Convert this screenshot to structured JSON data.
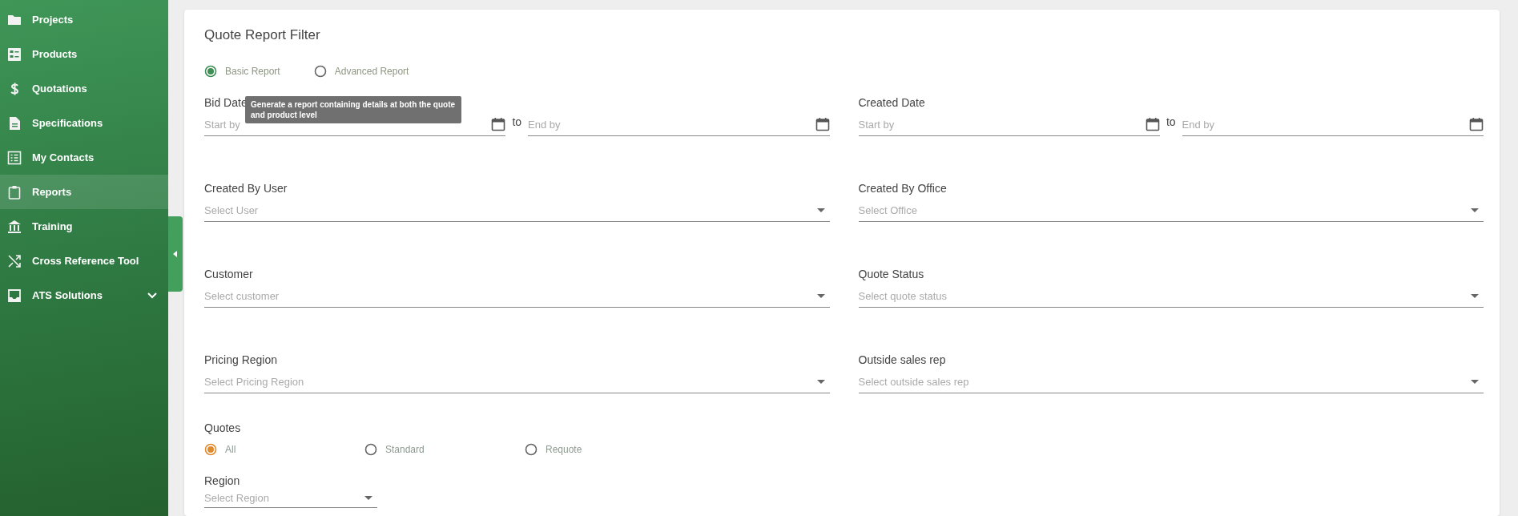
{
  "sidebar": {
    "items": [
      {
        "label": "Projects",
        "kind": "link",
        "selected": false
      },
      {
        "label": "Products",
        "kind": "link",
        "selected": false
      },
      {
        "label": "Quotations",
        "kind": "link",
        "selected": false
      },
      {
        "label": "Specifications",
        "kind": "link",
        "selected": false
      },
      {
        "label": "My Contacts",
        "kind": "link",
        "selected": false
      },
      {
        "label": "Reports",
        "kind": "link",
        "selected": true
      },
      {
        "label": "Training",
        "kind": "link",
        "selected": false
      },
      {
        "label": "Cross Reference Tool",
        "kind": "link",
        "selected": false
      },
      {
        "label": "ATS Solutions",
        "kind": "group",
        "selected": false
      }
    ]
  },
  "filter": {
    "title": "Quote Report Filter",
    "report_types": [
      {
        "label": "Basic Report",
        "selected": true
      },
      {
        "label": "Advanced Report",
        "selected": false
      }
    ],
    "tooltip": "Generate a report containing details at both the quote and product level",
    "fields": [
      {
        "kind": "date_range",
        "label": "Bid Date",
        "start_placeholder": "Start by",
        "separator": "to",
        "end_placeholder": "End by"
      },
      {
        "kind": "date_range",
        "label": "Created Date",
        "start_placeholder": "Start by",
        "separator": "to",
        "end_placeholder": "End by"
      },
      {
        "kind": "select",
        "label": "Created By User",
        "placeholder": "Select User"
      },
      {
        "kind": "select",
        "label": "Created By Office",
        "placeholder": "Select Office"
      },
      {
        "kind": "select",
        "label": "Customer",
        "placeholder": "Select customer"
      },
      {
        "kind": "select",
        "label": "Quote Status",
        "placeholder": "Select quote status"
      },
      {
        "kind": "select",
        "label": "Pricing Region",
        "placeholder": "Select Pricing Region"
      },
      {
        "kind": "select",
        "label": "Outside sales rep",
        "placeholder": "Select outside sales rep"
      }
    ],
    "quotes": {
      "label": "Quotes",
      "options": [
        {
          "label": "All",
          "selected": true
        },
        {
          "label": "Standard",
          "selected": false
        },
        {
          "label": "Requote",
          "selected": false
        }
      ]
    },
    "region": {
      "label": "Region",
      "placeholder": "Select Region"
    }
  }
}
